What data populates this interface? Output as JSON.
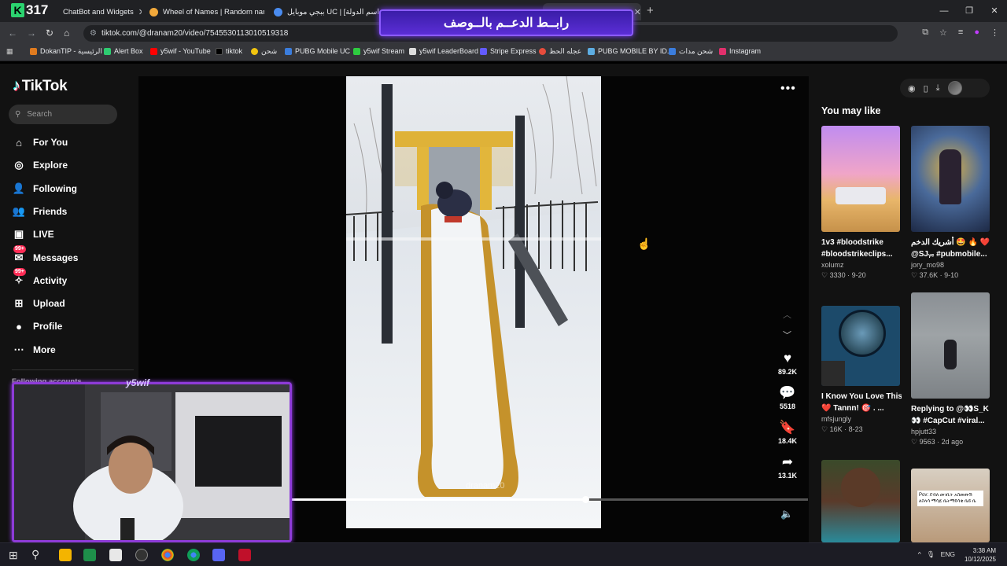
{
  "browser": {
    "tabs": [
      {
        "label": "ChatBot and Widgets",
        "close": "✕",
        "color": "#1f8b4c"
      },
      {
        "label": "Wheel of Names | Random nam",
        "close": "✕",
        "color": "#f2a93b"
      },
      {
        "label": "ببجي موبايل UC | [اسم الدولة] ...",
        "close": "✕",
        "color": "#4a8cf0"
      }
    ],
    "new_tab": "+",
    "streak_badge_letter": "K",
    "streak_badge_value": "317",
    "banner_text": "رابــط الدعــم بالــوصف",
    "url": "tiktok.com/@dranam20/video/7545530113010519318",
    "bookmarks": [
      {
        "label": "DokanTIP - الرئيسية",
        "color": "#e07b1f"
      },
      {
        "label": "Alert Box",
        "color": "#2ecc71"
      },
      {
        "label": "y5wif - YouTube",
        "color": "#ff0000"
      },
      {
        "label": "tiktok",
        "color": "#111111"
      },
      {
        "label": "شحن",
        "color": "#f1c40f"
      },
      {
        "label": "PUBG Mobile UC",
        "color": "#3b7ddd"
      },
      {
        "label": "y5wif Stream",
        "color": "#2ecc40"
      },
      {
        "label": "y5wif LeaderBoard",
        "color": "#dddddd"
      },
      {
        "label": "Stripe Express",
        "color": "#635bff"
      },
      {
        "label": "عجله الحظ",
        "color": "#e74c3c"
      },
      {
        "label": "PUBG MOBILE BY ID...",
        "color": "#5dade2"
      },
      {
        "label": "شحن مدات",
        "color": "#3b7ddd"
      },
      {
        "label": "Instagram",
        "color": "#e1306c"
      }
    ]
  },
  "tiktok": {
    "logo": "TikTok",
    "search_placeholder": "Search",
    "nav": [
      {
        "label": "For You",
        "icon": "home-icon",
        "glyph": "⌂"
      },
      {
        "label": "Explore",
        "icon": "compass-icon",
        "glyph": "◎"
      },
      {
        "label": "Following",
        "icon": "user-follow-icon",
        "glyph": "👤"
      },
      {
        "label": "Friends",
        "icon": "friends-icon",
        "glyph": "👥"
      },
      {
        "label": "LIVE",
        "icon": "live-icon",
        "glyph": "▣"
      },
      {
        "label": "Messages",
        "icon": "messages-icon",
        "glyph": "✉",
        "badge": "99+"
      },
      {
        "label": "Activity",
        "icon": "activity-icon",
        "glyph": "✧",
        "badge": "99+"
      },
      {
        "label": "Upload",
        "icon": "upload-icon",
        "glyph": "⊞"
      },
      {
        "label": "Profile",
        "icon": "profile-avatar",
        "glyph": "●"
      },
      {
        "label": "More",
        "icon": "more-icon",
        "glyph": "⋯"
      }
    ],
    "following_accounts_label": "Following accounts",
    "actions": {
      "likes": "89.2K",
      "comments": "5518",
      "saves": "18.4K",
      "shares": "13.1K"
    },
    "video_watermark": "dranam20",
    "progress_fraction": 0.57,
    "you_may_like": "You may like",
    "cards": [
      {
        "title": "1v3 #bloodstrike #bloodstrikeclips...",
        "author": "xolumz",
        "likes": "3330",
        "date": "9-20"
      },
      {
        "title": "أشريك الدخم 🤩 🔥 ❤️ @SJᵧₑ #pubmobile...",
        "author": "jory_mo98",
        "likes": "37.6K",
        "date": "9-10"
      },
      {
        "title": "I Know You Love This ❤️ Tannn! 🎯 . ...",
        "author": "mfsjungly",
        "likes": "16K",
        "date": "8-23"
      },
      {
        "title": "Replying to @👀S_K 👀 #CapCut #viral...",
        "author": "hpjutt33",
        "likes": "9563",
        "date": "2d ago"
      },
      {
        "title": "",
        "author": "",
        "likes": "",
        "date": ""
      },
      {
        "title": "",
        "author": "",
        "likes": "",
        "date": ""
      }
    ],
    "card5_overlay": "Pov: ደብለ መገቢት አስመጡሽ ለስላሳ ማሳጅ ቤትማይሳቁ ቤይ ቤ"
  },
  "stream": {
    "cam_logo": "y5wif"
  },
  "taskbar": {
    "time": "3:38 AM",
    "date": "10/12/2025",
    "lang": "ENG"
  }
}
